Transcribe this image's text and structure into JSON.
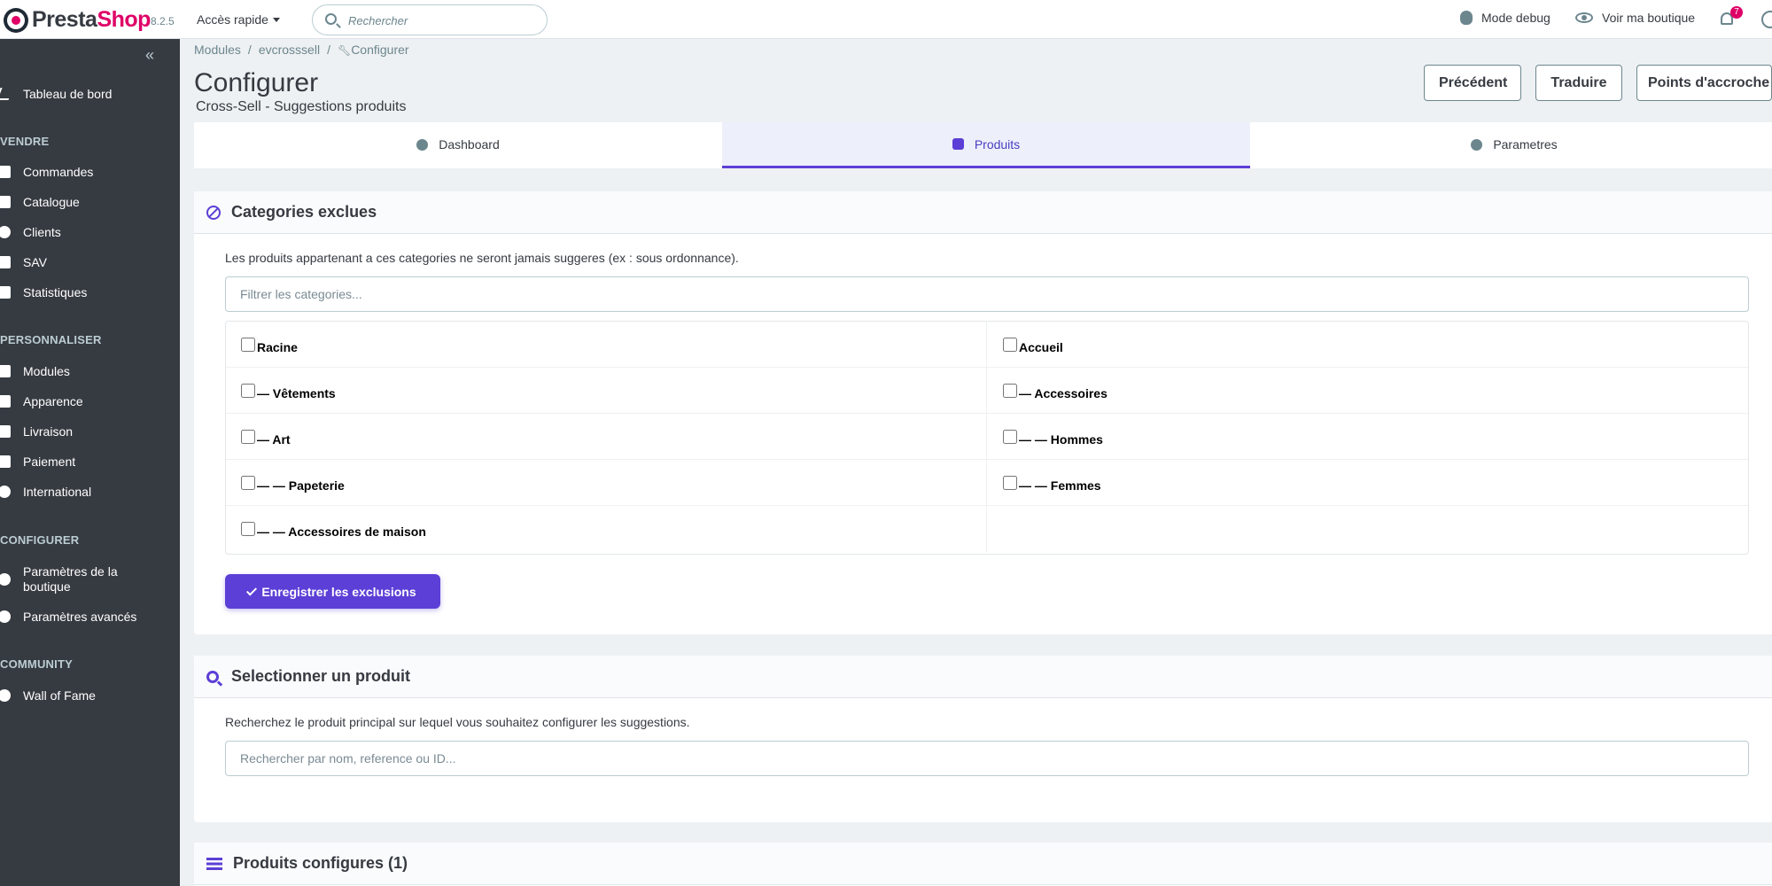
{
  "header": {
    "logo_main": "Presta",
    "logo_accent": "Shop",
    "version": "8.2.5",
    "quick_access": "Accès rapide",
    "search_placeholder": "Rechercher",
    "debug_label": "Mode debug",
    "view_shop_label": "Voir ma boutique",
    "notifications_count": "7"
  },
  "sidebar": {
    "collapse_icon": "«",
    "dashboard": "Tableau de bord",
    "sections": {
      "sell": "VENDRE",
      "customize": "PERSONNALISER",
      "configure": "CONFIGURER",
      "community": "COMMUNITY"
    },
    "sell_items": [
      "Commandes",
      "Catalogue",
      "Clients",
      "SAV",
      "Statistiques"
    ],
    "customize_items": [
      "Modules",
      "Apparence",
      "Livraison",
      "Paiement",
      "International"
    ],
    "configure_items": [
      "Paramètres de la boutique",
      "Paramètres avancés"
    ],
    "community_items": [
      "Wall of Fame"
    ]
  },
  "breadcrumb": [
    "Modules",
    "evcrosssell",
    "Configurer"
  ],
  "page": {
    "title": "Configurer",
    "subtitle": "Cross-Sell - Suggestions produits"
  },
  "toolbar": {
    "previous": "Précédent",
    "translate": "Traduire",
    "hooks": "Points d'accroche"
  },
  "tabs": [
    {
      "label": "Dashboard",
      "icon": "dashboard-icon"
    },
    {
      "label": "Produits",
      "icon": "cube-icon",
      "active": true
    },
    {
      "label": "Parametres",
      "icon": "cogs-icon"
    }
  ],
  "excluded": {
    "title": "Categories exclues",
    "description": "Les produits appartenant a ces categories ne seront jamais suggeres (ex : sous ordonnance).",
    "filter_placeholder": "Filtrer les categories...",
    "categories": [
      "Racine",
      "Accueil",
      "— Vêtements",
      "— Accessoires",
      "— Art",
      "— — Hommes",
      "— — Papeterie",
      "— — Femmes",
      "— — Accessoires de maison"
    ],
    "save_label": "Enregistrer les exclusions"
  },
  "select_product": {
    "title": "Selectionner un produit",
    "description": "Recherchez le produit principal sur lequel vous souhaitez configurer les suggestions.",
    "search_placeholder": "Rechercher par nom, reference ou ID..."
  },
  "configured": {
    "title": "Produits configures (1)"
  },
  "colors": {
    "accent": "#5c3fd6",
    "sidebar_bg": "#363a41",
    "brand": "#df0067"
  }
}
